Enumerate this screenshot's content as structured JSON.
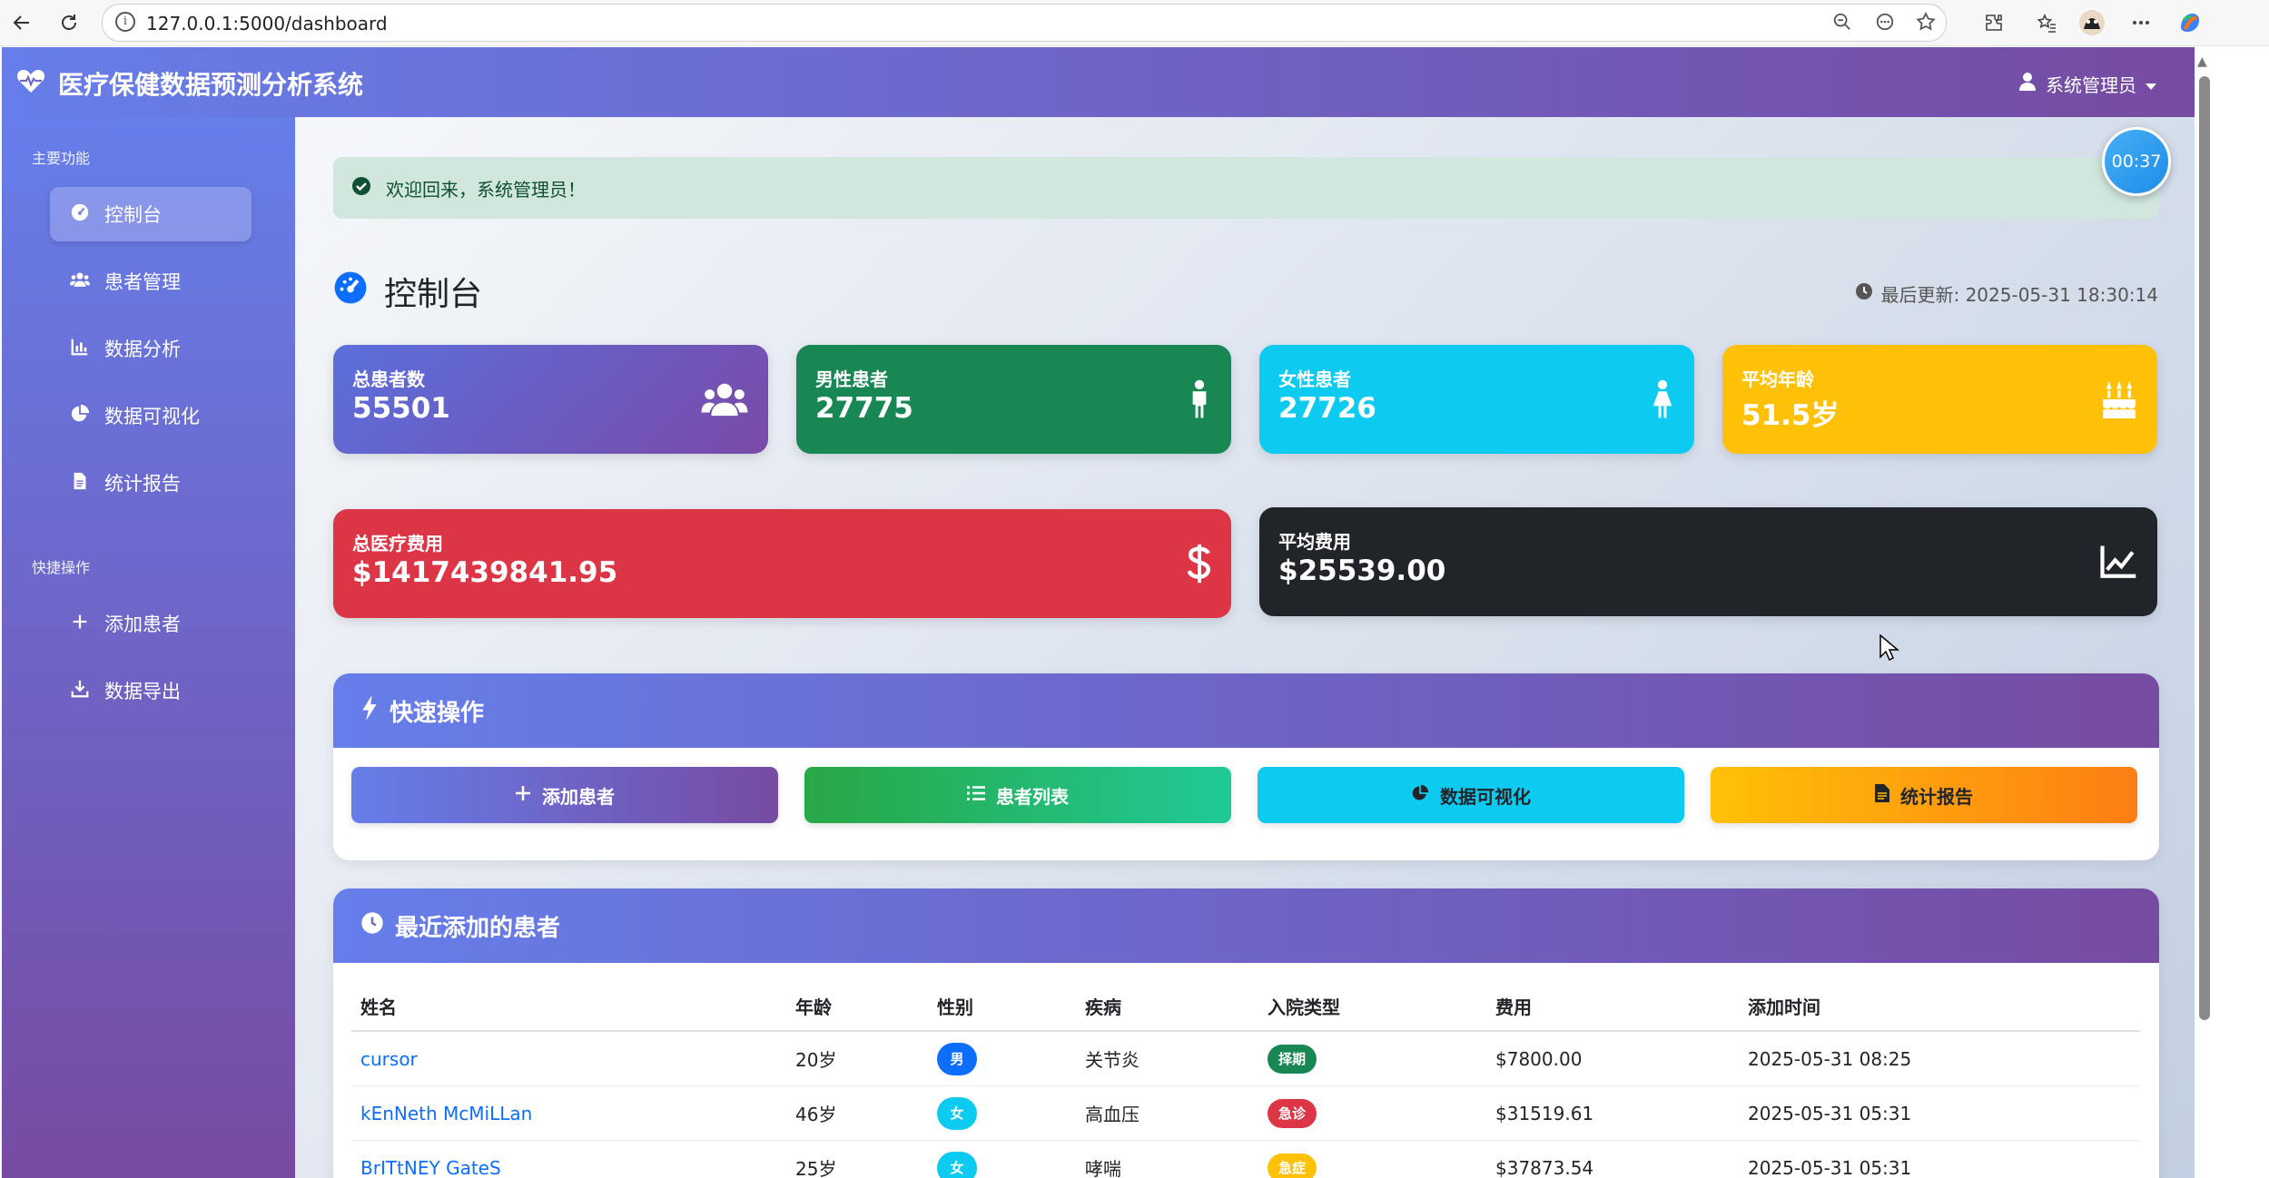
{
  "browser": {
    "url": "127.0.0.1:5000/dashboard",
    "info_glyph": "i"
  },
  "header": {
    "brand": "医疗保健数据预测分析系统",
    "user": "系统管理员"
  },
  "sidebar": {
    "section_main": "主要功能",
    "section_quick": "快捷操作",
    "items": [
      {
        "label": "控制台",
        "icon": "dashboard-icon"
      },
      {
        "label": "患者管理",
        "icon": "users-icon"
      },
      {
        "label": "数据分析",
        "icon": "chart-bar-icon"
      },
      {
        "label": "数据可视化",
        "icon": "chart-pie-icon"
      },
      {
        "label": "统计报告",
        "icon": "file-icon"
      }
    ],
    "quick_items": [
      {
        "label": "添加患者",
        "icon": "plus-icon"
      },
      {
        "label": "数据导出",
        "icon": "download-icon"
      }
    ]
  },
  "alert": {
    "message": "欢迎回来，系统管理员！"
  },
  "timer": "00:37",
  "page": {
    "title": "控制台",
    "last_update": "最后更新: 2025-05-31 18:30:14"
  },
  "stats": [
    {
      "label": "总患者数",
      "value": "55501",
      "color": "#6f5bc9",
      "icon": "users-icon"
    },
    {
      "label": "男性患者",
      "value": "27775",
      "color": "#198754",
      "icon": "male-icon"
    },
    {
      "label": "女性患者",
      "value": "27726",
      "color": "#0dcaf0",
      "icon": "female-icon"
    },
    {
      "label": "平均年龄",
      "value": "51.5岁",
      "color": "#ffc107",
      "icon": "birthday-cake-icon"
    },
    {
      "label": "总医疗费用",
      "value": "$1417439841.95",
      "color": "#dc3545",
      "icon": "dollar-icon"
    },
    {
      "label": "平均费用",
      "value": "$25539.00",
      "color": "#212529",
      "icon": "chart-line-icon"
    }
  ],
  "quick_actions": {
    "title": "快速操作",
    "buttons": [
      {
        "label": "添加患者",
        "icon": "plus-icon"
      },
      {
        "label": "患者列表",
        "icon": "list-icon"
      },
      {
        "label": "数据可视化",
        "icon": "chart-pie-icon"
      },
      {
        "label": "统计报告",
        "icon": "file-icon"
      }
    ]
  },
  "recent": {
    "title": "最近添加的患者",
    "columns": [
      "姓名",
      "年龄",
      "性别",
      "疾病",
      "入院类型",
      "费用",
      "添加时间"
    ],
    "rows": [
      {
        "name": "cursor",
        "age": "20岁",
        "sex": "男",
        "sex_color": "#0d6efd",
        "disease": "关节炎",
        "admission": "择期",
        "adm_color": "#198754",
        "cost": "$7800.00",
        "time": "2025-05-31 08:25"
      },
      {
        "name": "kEnNeth McMiLLan",
        "age": "46岁",
        "sex": "女",
        "sex_color": "#0dcaf0",
        "disease": "高血压",
        "admission": "急诊",
        "adm_color": "#dc3545",
        "cost": "$31519.61",
        "time": "2025-05-31 05:31"
      },
      {
        "name": "BrITtNEY GateS",
        "age": "25岁",
        "sex": "女",
        "sex_color": "#0dcaf0",
        "disease": "哮喘",
        "admission": "急症",
        "adm_color": "#ffc107",
        "cost": "$37873.54",
        "time": "2025-05-31 05:31"
      }
    ]
  }
}
